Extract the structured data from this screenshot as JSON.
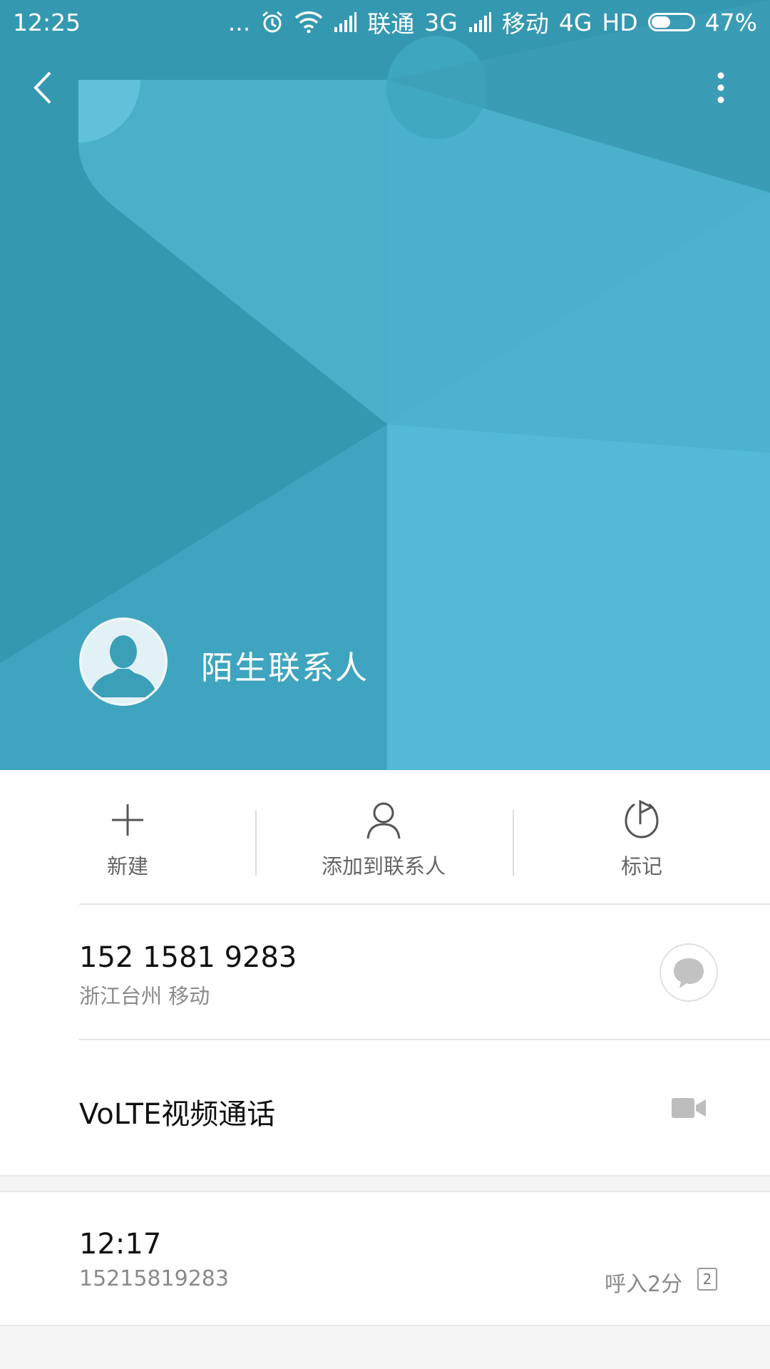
{
  "status_bar": {
    "time": "12:25",
    "dots": "...",
    "carrier1": "联通",
    "net1": "3G",
    "carrier2": "移动",
    "net2": "4G",
    "hd": "HD",
    "battery_percent": "47%",
    "battery_level": 0.47
  },
  "contact": {
    "name": "陌生联系人"
  },
  "actions": [
    {
      "label": "新建",
      "icon": "plus-icon"
    },
    {
      "label": "添加到联系人",
      "icon": "person-icon"
    },
    {
      "label": "标记",
      "icon": "flag-icon"
    }
  ],
  "phone": {
    "number": "152 1581 9283",
    "location": "浙江台州 移动"
  },
  "volte": {
    "label": "VoLTE视频通话"
  },
  "call_log": [
    {
      "time": "12:17",
      "number": "15215819283",
      "type": "呼入2分",
      "sim": "2"
    }
  ],
  "colors": {
    "hero_base": "#3aa2ba",
    "hero_light": "#53b8d6",
    "icon_gray": "#bdbdbd"
  }
}
